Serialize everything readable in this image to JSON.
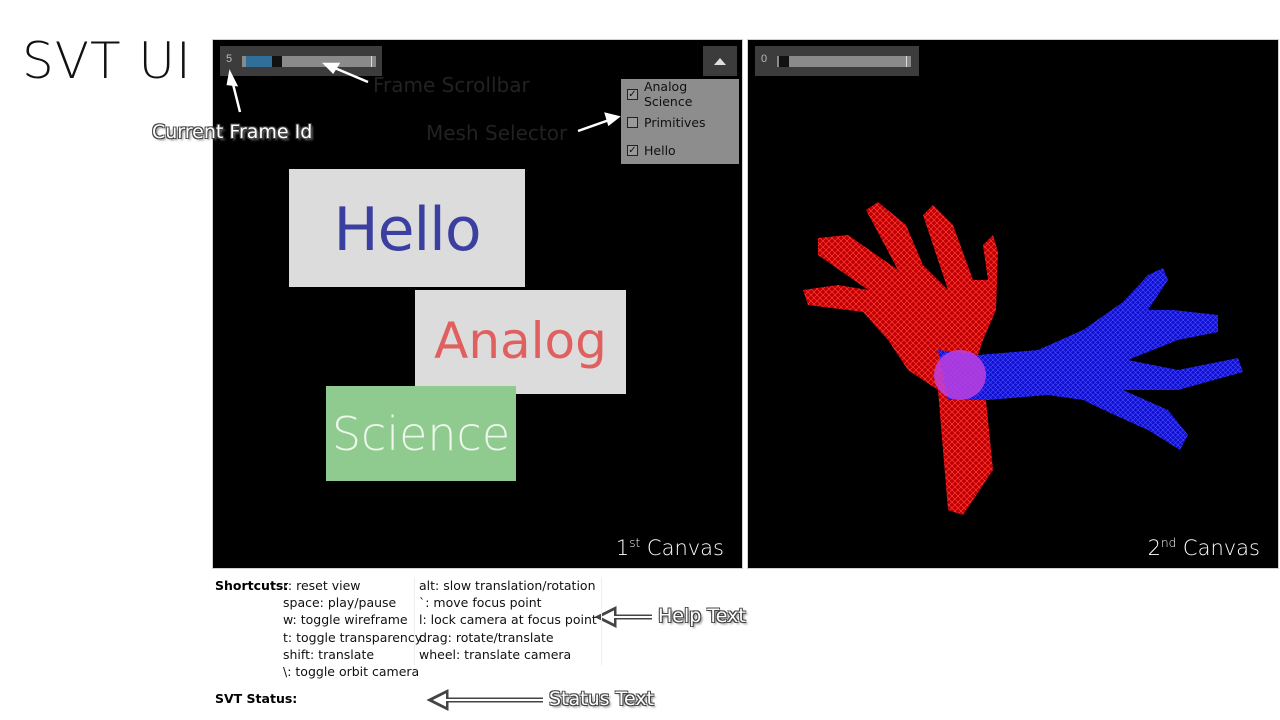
{
  "title": "SVT UI",
  "canvas1": {
    "label_num": "1",
    "label_sup": "st",
    "label_word": " Canvas",
    "frame_id": "5"
  },
  "canvas2": {
    "label_num": "2",
    "label_sup": "nd",
    "label_word": " Canvas",
    "frame_id": "0"
  },
  "mesh_selector": {
    "items": [
      {
        "label": "Analog Science",
        "checked": true
      },
      {
        "label": "Primitives",
        "checked": false
      },
      {
        "label": "Hello",
        "checked": true
      }
    ]
  },
  "cards": {
    "hello": "Hello",
    "analog": "Analog",
    "science": "Science"
  },
  "annotations": {
    "frame_scrollbar": "Frame Scrollbar",
    "current_frame_id": "Current Frame Id",
    "mesh_selector": "Mesh Selector",
    "help_text": "Help Text",
    "status_text": "Status Text"
  },
  "help": {
    "label": "Shortcuts:",
    "col1": [
      "r: reset view",
      "space: play/pause",
      "w: toggle wireframe",
      "t: toggle transparency",
      "shift: translate",
      "\\: toggle orbit camera"
    ],
    "col2": [
      "alt: slow translation/rotation",
      "`: move focus point",
      "l: lock camera at focus point",
      "drag: rotate/translate",
      "wheel: translate camera"
    ]
  },
  "status": {
    "label": "SVT Status:",
    "value": ""
  },
  "colors": {
    "left_hand": "#ff2020",
    "right_hand": "#2020ff",
    "overlap": "#b040d0"
  }
}
